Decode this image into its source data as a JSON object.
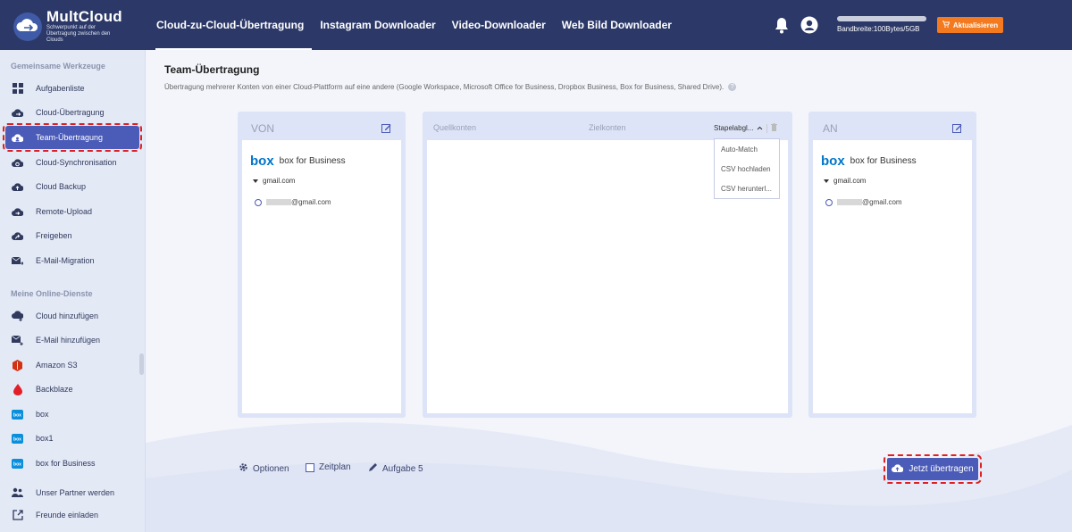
{
  "header": {
    "logo_title": "MultCloud",
    "logo_subtitle": "Schwerpunkt auf der Übertragung zwischen den Clouds",
    "nav": [
      {
        "label": "Cloud-zu-Cloud-Übertragung",
        "active": true
      },
      {
        "label": "Instagram Downloader",
        "active": false
      },
      {
        "label": "Video-Downloader",
        "active": false
      },
      {
        "label": "Web Bild Downloader",
        "active": false
      }
    ],
    "bandwidth": "Bandbreite:100Bytes/5GB",
    "upgrade": "Aktualisieren"
  },
  "sidebar": {
    "section1": "Gemeinsame Werkzeuge",
    "tools": [
      {
        "label": "Aufgabenliste",
        "icon": "grid-icon"
      },
      {
        "label": "Cloud-Übertragung",
        "icon": "cloud-transfer-icon"
      },
      {
        "label": "Team-Übertragung",
        "icon": "team-transfer-icon",
        "active": true
      },
      {
        "label": "Cloud-Synchronisation",
        "icon": "cloud-sync-icon"
      },
      {
        "label": "Cloud Backup",
        "icon": "cloud-backup-icon"
      },
      {
        "label": "Remote-Upload",
        "icon": "remote-upload-icon"
      },
      {
        "label": "Freigeben",
        "icon": "share-icon"
      },
      {
        "label": "E-Mail-Migration",
        "icon": "email-migration-icon"
      }
    ],
    "section2": "Meine Online-Dienste",
    "services": [
      {
        "label": "Cloud hinzufügen",
        "icon": "cloud-add-icon"
      },
      {
        "label": "E-Mail hinzufügen",
        "icon": "email-add-icon"
      },
      {
        "label": "Amazon S3",
        "icon": "amazon-s3-icon"
      },
      {
        "label": "Backblaze",
        "icon": "backblaze-icon"
      },
      {
        "label": "box",
        "icon": "box-icon"
      },
      {
        "label": "box1",
        "icon": "box-icon"
      },
      {
        "label": "box for Business",
        "icon": "box-icon"
      }
    ],
    "bottom": [
      {
        "label": "Unser Partner werden",
        "icon": "partner-icon"
      },
      {
        "label": "Freunde einladen",
        "icon": "invite-icon"
      }
    ]
  },
  "main": {
    "title": "Team-Übertragung",
    "description": "Übertragung mehrerer Konten von einer Cloud-Plattform auf eine andere (Google Workspace, Microsoft Office for Business, Dropbox Business, Box for Business, Shared Drive).",
    "from": {
      "heading": "VON",
      "brand_logo": "box",
      "brand": "box for Business",
      "domain": "gmail.com",
      "account": "@gmail.com"
    },
    "middle": {
      "source_header": "Quellkonten",
      "target_header": "Zielkonten",
      "batch_label": "Stapelabgl...",
      "batch_menu": [
        "Auto-Match",
        "CSV hochladen",
        "CSV herunterl..."
      ]
    },
    "to": {
      "heading": "AN",
      "brand_logo": "box",
      "brand": "box for Business",
      "domain": "gmail.com",
      "account": "@gmail.com"
    },
    "footer": {
      "options": "Optionen",
      "schedule": "Zeitplan",
      "task": "Aufgabe 5",
      "transfer_button": "Jetzt übertragen"
    }
  },
  "colors": {
    "header_bg": "#2c3968",
    "accent": "#4b5bb8",
    "upgrade": "#f47a1f",
    "highlight_outline": "#e02020"
  }
}
